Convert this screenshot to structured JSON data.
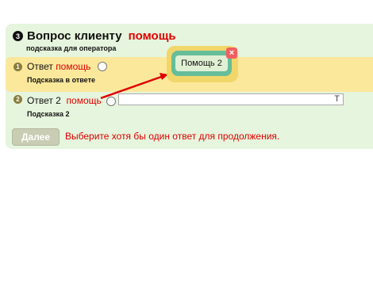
{
  "question": {
    "number": "3",
    "title": "Вопрос клиенту",
    "help": "помощь",
    "hint": "подсказка для оператора"
  },
  "answers": [
    {
      "number": "1",
      "label": "Ответ",
      "help": "помощь",
      "hint": "Подсказка в ответе"
    },
    {
      "number": "2",
      "label": "Ответ 2",
      "help": "помощь",
      "hint": "Подсказка 2",
      "input_value": "",
      "input_icon": "T"
    }
  ],
  "next_button": "Далее",
  "validation_message": "Выберите хотя бы один ответ для продолжения.",
  "tooltip": {
    "label": "Помощь 2",
    "close": "×"
  },
  "colors": {
    "panel": "#e6f5dd",
    "selected_answer": "#fbe89b",
    "help_text": "#e00000",
    "tooltip_frame": "#f1d66a",
    "tooltip_inner": "#66bd9a",
    "close_button": "#f06060"
  }
}
